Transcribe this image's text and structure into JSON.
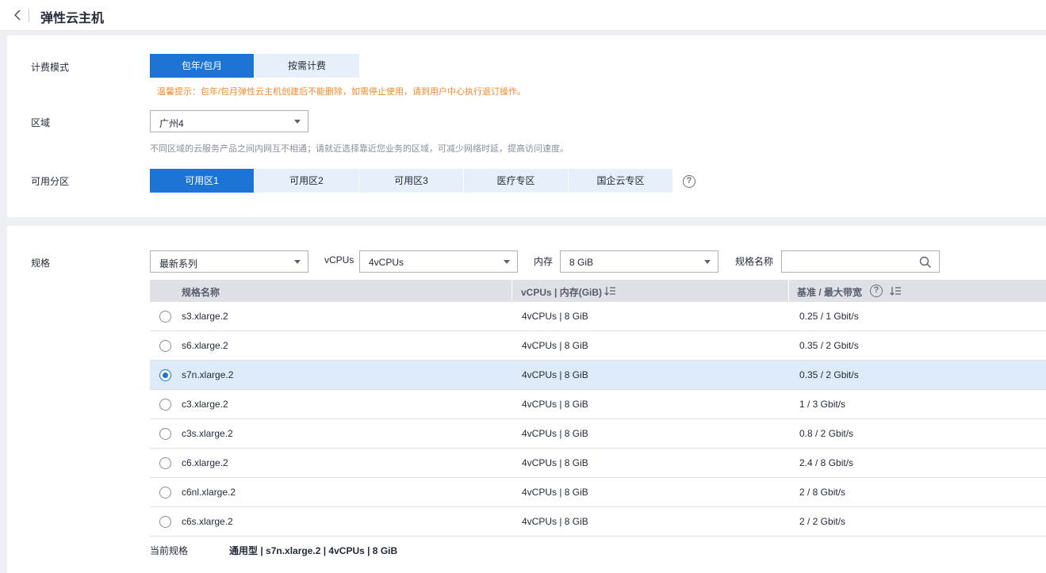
{
  "header": {
    "title": "弹性云主机"
  },
  "billing": {
    "label": "计费模式",
    "options": [
      "包年/包月",
      "按需计费"
    ],
    "selected": 0,
    "hint": "温馨提示：包年/包月弹性云主机创建后不能删除，如需停止使用，请到用户中心执行退订操作。"
  },
  "region": {
    "label": "区域",
    "value": "广州4",
    "hint": "不同区域的云服务产品之间内网互不相通；请就近选择靠近您业务的区域，可减少网络时延，提高访问速度。"
  },
  "az": {
    "label": "可用分区",
    "options": [
      "可用区1",
      "可用区2",
      "可用区3",
      "医疗专区",
      "国企云专区"
    ],
    "selected": 0,
    "help_icon": "question-circle-icon"
  },
  "spec": {
    "label": "规格",
    "series_value": "最新系列",
    "vcpu_label": "vCPUs",
    "vcpu_value": "4vCPUs",
    "mem_label": "内存",
    "mem_value": "8 GiB",
    "name_label": "规格名称",
    "search_placeholder": "",
    "columns": [
      "规格名称",
      "vCPUs | 内存(GiB)",
      "基准 / 最大带宽"
    ],
    "rows": [
      {
        "name": "s3.xlarge.2",
        "cpu_mem": "4vCPUs | 8 GiB",
        "bandwidth": "0.25 / 1 Gbit/s",
        "selected": false
      },
      {
        "name": "s6.xlarge.2",
        "cpu_mem": "4vCPUs | 8 GiB",
        "bandwidth": "0.35 / 2 Gbit/s",
        "selected": false
      },
      {
        "name": "s7n.xlarge.2",
        "cpu_mem": "4vCPUs | 8 GiB",
        "bandwidth": "0.35 / 2 Gbit/s",
        "selected": true
      },
      {
        "name": "c3.xlarge.2",
        "cpu_mem": "4vCPUs | 8 GiB",
        "bandwidth": "1 / 3 Gbit/s",
        "selected": false
      },
      {
        "name": "c3s.xlarge.2",
        "cpu_mem": "4vCPUs | 8 GiB",
        "bandwidth": "0.8 / 2 Gbit/s",
        "selected": false
      },
      {
        "name": "c6.xlarge.2",
        "cpu_mem": "4vCPUs | 8 GiB",
        "bandwidth": "2.4 / 8 Gbit/s",
        "selected": false
      },
      {
        "name": "c6nl.xlarge.2",
        "cpu_mem": "4vCPUs | 8 GiB",
        "bandwidth": "2 / 8 Gbit/s",
        "selected": false
      },
      {
        "name": "c6s.xlarge.2",
        "cpu_mem": "4vCPUs | 8 GiB",
        "bandwidth": "2 / 2 Gbit/s",
        "selected": false
      }
    ],
    "current_label": "当前规格",
    "current_value": "通用型 | s7n.xlarge.2 | 4vCPUs | 8 GiB"
  },
  "colors": {
    "accent": "#1e74d4",
    "segment_bg": "#e6f0fb",
    "hint_orange": "#f08a2f",
    "selected_row": "#dcebf7"
  }
}
